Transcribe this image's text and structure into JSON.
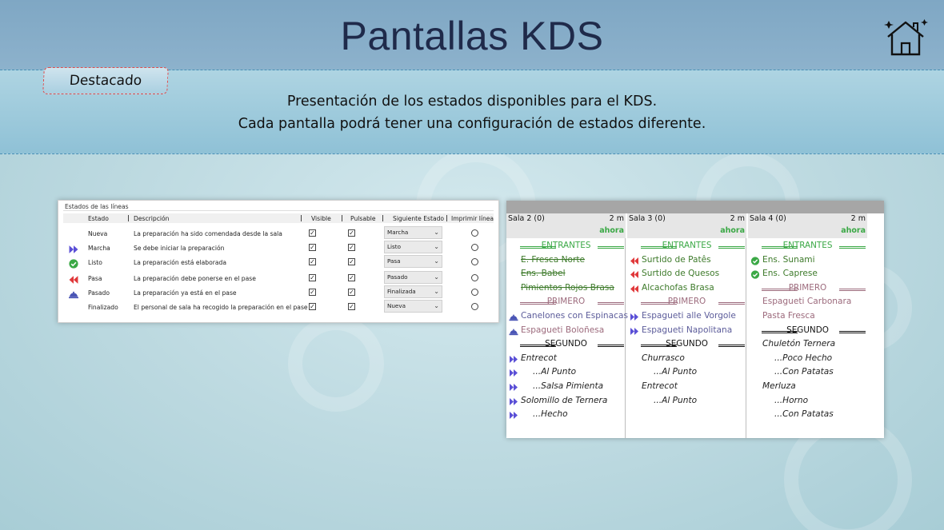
{
  "slide": {
    "title": "Pantallas KDS",
    "tag": "Destacado",
    "info_line1": "Presentación de los estados disponibles para el KDS.",
    "info_line2": "Cada pantalla podrá tener una configuración de estados diferente.",
    "home_icon": "home-icon"
  },
  "states": {
    "legend": "Estados de las líneas",
    "headers": {
      "estado": "Estado",
      "descripcion": "Descripción",
      "visible": "Visible",
      "pulsable": "Pulsable",
      "siguiente": "Siguiente Estado",
      "imprimir": "Imprimir línea"
    },
    "rows": [
      {
        "icon": "none",
        "estado": "Nueva",
        "descripcion": "La preparación ha sido comendada desde la sala",
        "siguiente": "Marcha"
      },
      {
        "icon": "double-arrow-right-icon",
        "estado": "Marcha",
        "descripcion": "Se debe iniciar la preparación",
        "siguiente": "Listo"
      },
      {
        "icon": "check-circle-icon",
        "estado": "Listo",
        "descripcion": "La preparación está elaborada",
        "siguiente": "Pasa"
      },
      {
        "icon": "double-arrow-left-icon",
        "estado": "Pasa",
        "descripcion": "La preparación debe ponerse en el pase",
        "siguiente": "Pasado"
      },
      {
        "icon": "cloche-icon",
        "estado": "Pasado",
        "descripcion": "La preparación ya está en el pase",
        "siguiente": "Finalizada"
      },
      {
        "icon": "none",
        "estado": "Finalizado",
        "descripcion": "El personal de sala ha recogido la preparación en el pase",
        "siguiente": "Nueva"
      }
    ]
  },
  "kds": {
    "columns": [
      {
        "sala": "Sala 2 (0)",
        "time": "2 m",
        "ahora": "ahora",
        "lines": [
          {
            "kind": "divider",
            "text": "ENTRANTES",
            "color": "#3aa845"
          },
          {
            "kind": "item",
            "icon": "none",
            "text": "E. Fresca Norte",
            "color": "#3d7a2a",
            "strike": true,
            "italic": false,
            "indent": false
          },
          {
            "kind": "item",
            "icon": "none",
            "text": "Ens. Babel",
            "color": "#3d7a2a",
            "strike": true,
            "italic": false,
            "indent": false
          },
          {
            "kind": "item",
            "icon": "none",
            "text": "Pimientos Rojos Brasa",
            "color": "#3d7a2a",
            "strike": true,
            "italic": false,
            "indent": false
          },
          {
            "kind": "divider",
            "text": "PRIMERO",
            "color": "#9c6a7c"
          },
          {
            "kind": "item",
            "icon": "cloche-icon",
            "text": "Canelones con Espinacas",
            "color": "#5c5c9a",
            "strike": false,
            "italic": false,
            "indent": false
          },
          {
            "kind": "item",
            "icon": "cloche-icon",
            "text": "Espagueti Boloñesa",
            "color": "#9c6a7c",
            "strike": false,
            "italic": false,
            "indent": false
          },
          {
            "kind": "divider",
            "text": "SEGUNDO",
            "color": "#111111"
          },
          {
            "kind": "item",
            "icon": "double-arrow-right-icon",
            "text": "Entrecot",
            "color": "#222222",
            "strike": false,
            "italic": true,
            "indent": false
          },
          {
            "kind": "item",
            "icon": "double-arrow-right-icon",
            "text": "...Al Punto",
            "color": "#222222",
            "strike": false,
            "italic": true,
            "indent": true
          },
          {
            "kind": "item",
            "icon": "double-arrow-right-icon",
            "text": "...Salsa Pimienta",
            "color": "#222222",
            "strike": false,
            "italic": true,
            "indent": true
          },
          {
            "kind": "item",
            "icon": "double-arrow-right-icon",
            "text": "Solomillo de Ternera",
            "color": "#222222",
            "strike": false,
            "italic": true,
            "indent": false
          },
          {
            "kind": "item",
            "icon": "double-arrow-right-icon",
            "text": "...Hecho",
            "color": "#222222",
            "strike": false,
            "italic": true,
            "indent": true
          }
        ]
      },
      {
        "sala": "Sala 3 (0)",
        "time": "2 m",
        "ahora": "ahora",
        "lines": [
          {
            "kind": "divider",
            "text": "ENTRANTES",
            "color": "#3aa845"
          },
          {
            "kind": "item",
            "icon": "double-arrow-left-icon",
            "text": "Surtido de Patês",
            "color": "#3d7a2a",
            "strike": false,
            "italic": false,
            "indent": false
          },
          {
            "kind": "item",
            "icon": "double-arrow-left-icon",
            "text": "Surtido de Quesos",
            "color": "#3d7a2a",
            "strike": false,
            "italic": false,
            "indent": false
          },
          {
            "kind": "item",
            "icon": "double-arrow-left-icon",
            "text": "Alcachofas Brasa",
            "color": "#3d7a2a",
            "strike": false,
            "italic": false,
            "indent": false
          },
          {
            "kind": "divider",
            "text": "PRIMERO",
            "color": "#9c6a7c"
          },
          {
            "kind": "item",
            "icon": "double-arrow-right-icon",
            "text": "Espagueti alle Vorgole",
            "color": "#5c5c9a",
            "strike": false,
            "italic": false,
            "indent": false
          },
          {
            "kind": "item",
            "icon": "double-arrow-right-icon",
            "text": "Espagueti Napolitana",
            "color": "#5c5c9a",
            "strike": false,
            "italic": false,
            "indent": false
          },
          {
            "kind": "divider",
            "text": "SEGUNDO",
            "color": "#111111"
          },
          {
            "kind": "item",
            "icon": "none",
            "text": "Churrasco",
            "color": "#222222",
            "strike": false,
            "italic": true,
            "indent": false
          },
          {
            "kind": "item",
            "icon": "none",
            "text": "...Al Punto",
            "color": "#222222",
            "strike": false,
            "italic": true,
            "indent": true
          },
          {
            "kind": "item",
            "icon": "none",
            "text": "Entrecot",
            "color": "#222222",
            "strike": false,
            "italic": true,
            "indent": false
          },
          {
            "kind": "item",
            "icon": "none",
            "text": "...Al Punto",
            "color": "#222222",
            "strike": false,
            "italic": true,
            "indent": true
          }
        ]
      },
      {
        "sala": "Sala 4 (0)",
        "time": "2 m",
        "ahora": "ahora",
        "lines": [
          {
            "kind": "divider",
            "text": "ENTRANTES",
            "color": "#3aa845"
          },
          {
            "kind": "item",
            "icon": "check-circle-icon",
            "text": "Ens. Sunami",
            "color": "#3d7a2a",
            "strike": false,
            "italic": false,
            "indent": false
          },
          {
            "kind": "item",
            "icon": "check-circle-icon",
            "text": "Ens. Caprese",
            "color": "#3d7a2a",
            "strike": false,
            "italic": false,
            "indent": false
          },
          {
            "kind": "divider",
            "text": "PRIMERO",
            "color": "#9c6a7c"
          },
          {
            "kind": "item",
            "icon": "none",
            "text": "Espagueti Carbonara",
            "color": "#9c6a7c",
            "strike": false,
            "italic": false,
            "indent": false
          },
          {
            "kind": "item",
            "icon": "none",
            "text": "Pasta Fresca",
            "color": "#9c6a7c",
            "strike": false,
            "italic": false,
            "indent": false
          },
          {
            "kind": "divider",
            "text": "SEGUNDO",
            "color": "#111111"
          },
          {
            "kind": "item",
            "icon": "none",
            "text": "Chuletón Ternera",
            "color": "#222222",
            "strike": false,
            "italic": true,
            "indent": false
          },
          {
            "kind": "item",
            "icon": "none",
            "text": "...Poco Hecho",
            "color": "#222222",
            "strike": false,
            "italic": true,
            "indent": true
          },
          {
            "kind": "item",
            "icon": "none",
            "text": "...Con Patatas",
            "color": "#222222",
            "strike": false,
            "italic": true,
            "indent": true
          },
          {
            "kind": "item",
            "icon": "none",
            "text": "Merluza",
            "color": "#222222",
            "strike": false,
            "italic": true,
            "indent": false
          },
          {
            "kind": "item",
            "icon": "none",
            "text": "...Horno",
            "color": "#222222",
            "strike": false,
            "italic": true,
            "indent": true
          },
          {
            "kind": "item",
            "icon": "none",
            "text": "...Con Patatas",
            "color": "#222222",
            "strike": false,
            "italic": true,
            "indent": true
          }
        ]
      }
    ]
  },
  "colors": {
    "arrow_right": "#5a4fd6",
    "arrow_left": "#e0383a",
    "check": "#3aa845",
    "cloche": "#4a55b5",
    "ahora": "#3aa845"
  }
}
